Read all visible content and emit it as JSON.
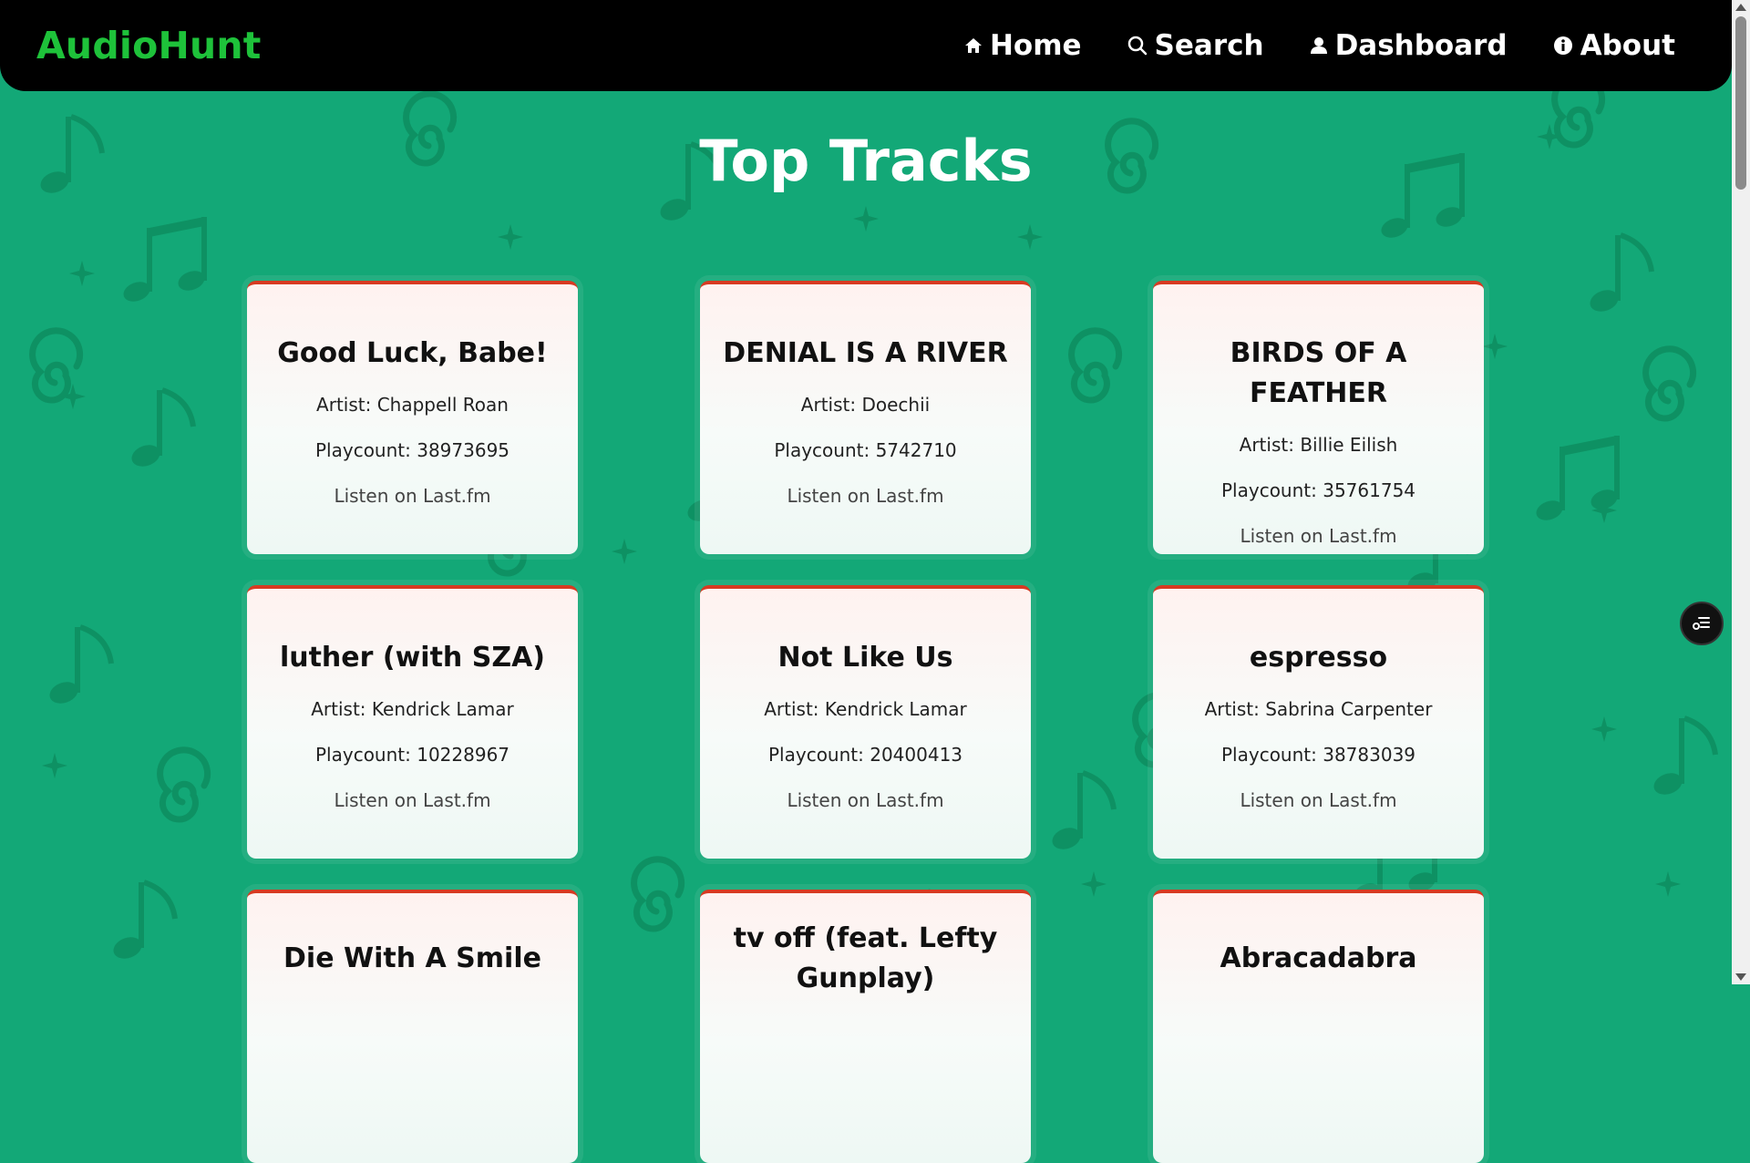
{
  "brand": "AudioHunt",
  "nav": [
    {
      "label": "Home",
      "icon": "home-icon"
    },
    {
      "label": "Search",
      "icon": "search-icon"
    },
    {
      "label": "Dashboard",
      "icon": "user-icon"
    },
    {
      "label": "About",
      "icon": "info-icon"
    }
  ],
  "page_title": "Top Tracks",
  "tracks": [
    {
      "title": "Good Luck, Babe!",
      "artist": "Artist: Chappell Roan",
      "playcount": "Playcount: 38973695",
      "link": "Listen on Last.fm"
    },
    {
      "title": "DENIAL IS A RIVER",
      "artist": "Artist: Doechii",
      "playcount": "Playcount: 5742710",
      "link": "Listen on Last.fm"
    },
    {
      "title": "BIRDS OF A FEATHER",
      "artist": "Artist: Billie Eilish",
      "playcount": "Playcount: 35761754",
      "link": "Listen on Last.fm"
    },
    {
      "title": "luther (with SZA)",
      "artist": "Artist: Kendrick Lamar",
      "playcount": "Playcount: 10228967",
      "link": "Listen on Last.fm"
    },
    {
      "title": "Not Like Us",
      "artist": "Artist: Kendrick Lamar",
      "playcount": "Playcount: 20400413",
      "link": "Listen on Last.fm"
    },
    {
      "title": "espresso",
      "artist": "Artist: Sabrina Carpenter",
      "playcount": "Playcount: 38783039",
      "link": "Listen on Last.fm"
    },
    {
      "title": "Die With A Smile"
    },
    {
      "title": "tv off (feat. Lefty Gunplay)"
    },
    {
      "title": "Abracadabra"
    }
  ],
  "colors": {
    "background": "#13a877",
    "navbar": "#000000",
    "brand": "#1ec23a",
    "card_accent": "#d83a22"
  }
}
